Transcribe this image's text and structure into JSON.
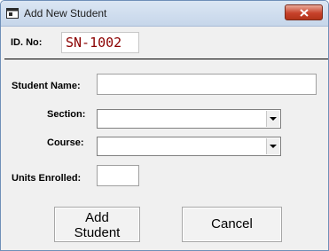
{
  "window": {
    "title": "Add New Student",
    "icon": "app-window-icon",
    "close_icon": "close-icon"
  },
  "form": {
    "id_label": "ID. No:",
    "id_value": "SN-1002",
    "student_name_label": "Student Name:",
    "student_name_value": "",
    "section_label": "Section:",
    "section_value": "",
    "course_label": "Course:",
    "course_value": "",
    "units_label": "Units Enrolled:",
    "units_value": ""
  },
  "buttons": {
    "add_line1": "Add",
    "add_line2": "Student",
    "cancel": "Cancel"
  },
  "colors": {
    "id_text": "#8b0000",
    "close_button": "#c7422b"
  }
}
